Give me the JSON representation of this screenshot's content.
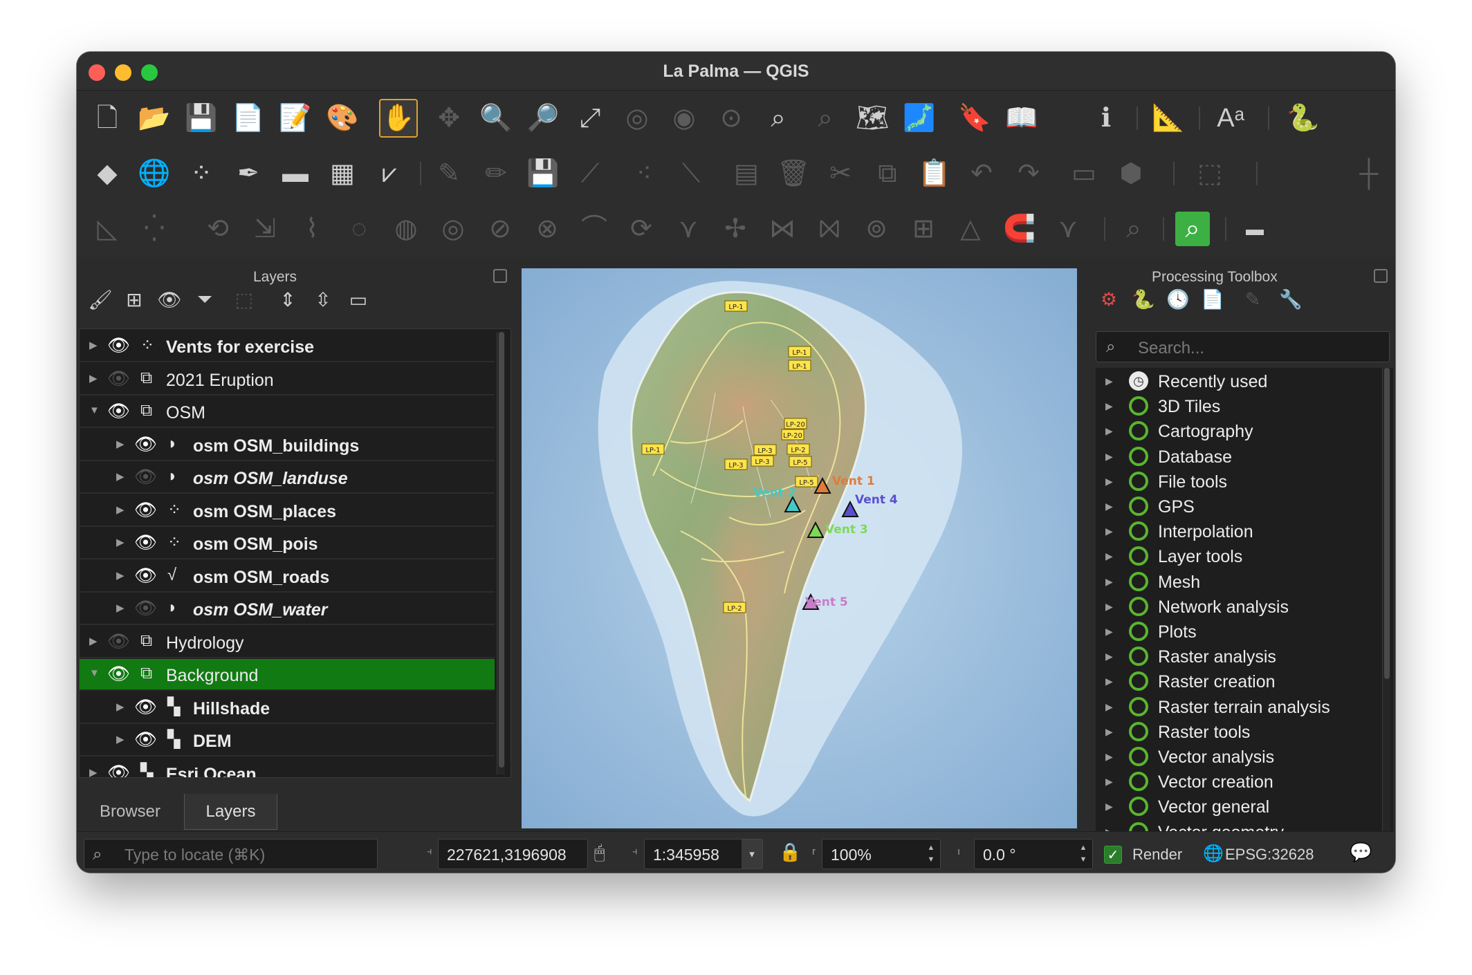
{
  "window": {
    "title": "La Palma — QGIS"
  },
  "layers_panel": {
    "title": "Layers",
    "items": [
      {
        "name": "Vents for exercise",
        "bold": true,
        "italic": false,
        "visible": true,
        "indent": 0,
        "expanded": false,
        "icon": "point-layer-icon"
      },
      {
        "name": "2021 Eruption",
        "bold": false,
        "italic": false,
        "visible": false,
        "indent": 0,
        "expanded": false,
        "icon": "group-icon"
      },
      {
        "name": "OSM",
        "bold": false,
        "italic": false,
        "visible": true,
        "indent": 0,
        "expanded": true,
        "icon": "group-icon"
      },
      {
        "name": "osm OSM_buildings",
        "bold": true,
        "italic": false,
        "visible": true,
        "indent": 1,
        "expanded": false,
        "icon": "polygon-layer-icon"
      },
      {
        "name": "osm OSM_landuse",
        "bold": true,
        "italic": true,
        "visible": false,
        "indent": 1,
        "expanded": false,
        "icon": "polygon-layer-icon"
      },
      {
        "name": "osm OSM_places",
        "bold": true,
        "italic": false,
        "visible": true,
        "indent": 1,
        "expanded": false,
        "icon": "point-layer-icon"
      },
      {
        "name": "osm OSM_pois",
        "bold": true,
        "italic": false,
        "visible": true,
        "indent": 1,
        "expanded": false,
        "icon": "point-layer-icon"
      },
      {
        "name": "osm OSM_roads",
        "bold": true,
        "italic": false,
        "visible": true,
        "indent": 1,
        "expanded": false,
        "icon": "line-layer-icon"
      },
      {
        "name": "osm OSM_water",
        "bold": true,
        "italic": true,
        "visible": false,
        "indent": 1,
        "expanded": false,
        "icon": "polygon-layer-icon"
      },
      {
        "name": "Hydrology",
        "bold": false,
        "italic": false,
        "visible": false,
        "indent": 0,
        "expanded": false,
        "icon": "group-icon"
      },
      {
        "name": "Background",
        "bold": false,
        "italic": false,
        "visible": true,
        "indent": 0,
        "expanded": true,
        "icon": "group-icon",
        "selected": true
      },
      {
        "name": "Hillshade",
        "bold": true,
        "italic": false,
        "visible": true,
        "indent": 1,
        "expanded": false,
        "icon": "raster-layer-icon"
      },
      {
        "name": "DEM",
        "bold": true,
        "italic": false,
        "visible": true,
        "indent": 1,
        "expanded": false,
        "icon": "raster-layer-icon"
      },
      {
        "name": "Esri Ocean",
        "bold": true,
        "italic": false,
        "visible": true,
        "indent": 0,
        "expanded": false,
        "icon": "raster-layer-icon"
      }
    ]
  },
  "bottom_tabs": [
    "Browser",
    "Layers"
  ],
  "active_tab": "Layers",
  "processing": {
    "title": "Processing Toolbox",
    "search_placeholder": "Search...",
    "items": [
      "Recently used",
      "3D Tiles",
      "Cartography",
      "Database",
      "File tools",
      "GPS",
      "Interpolation",
      "Layer tools",
      "Mesh",
      "Network analysis",
      "Plots",
      "Raster analysis",
      "Raster creation",
      "Raster terrain analysis",
      "Raster tools",
      "Vector analysis",
      "Vector creation",
      "Vector general",
      "Vector geometry"
    ]
  },
  "map": {
    "road_labels": [
      "LP-1",
      "LP-1",
      "LP-1",
      "LP-1",
      "LP-20",
      "LP-20",
      "LP-2",
      "LP-5",
      "LP-3",
      "LP-3",
      "LP-3",
      "LP-5",
      "LP-2"
    ],
    "vents": [
      {
        "label": "Vent 1",
        "color": "#e07b39"
      },
      {
        "label": "Vent 2",
        "color": "#45c8c8"
      },
      {
        "label": "Vent 3",
        "color": "#7ed957"
      },
      {
        "label": "Vent 4",
        "color": "#5a4fcf"
      },
      {
        "label": "Vent 5",
        "color": "#c77dc7"
      }
    ]
  },
  "statusbar": {
    "locate_placeholder": "Type to locate (⌘K)",
    "coordinate": "227621,3196908",
    "scale": "1:345958",
    "magnifier": "100%",
    "rotation": "0.0 °",
    "render_label": "Render",
    "crs": "EPSG:32628"
  },
  "colors": {
    "selection": "#127a12",
    "accent": "#e0a030",
    "qgis_green": "#5ab52e"
  }
}
